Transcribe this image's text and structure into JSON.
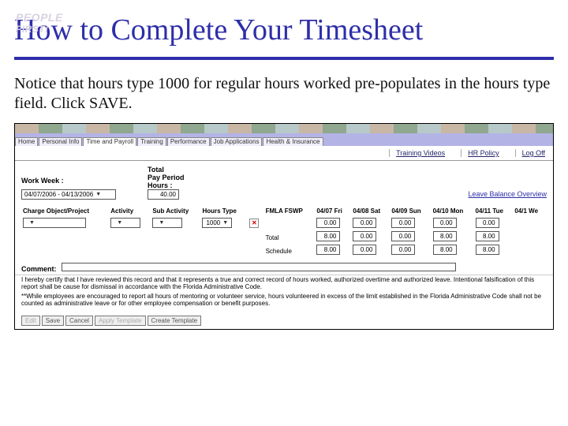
{
  "logo": {
    "line1": "PEOPLE",
    "line2": "FIRST!"
  },
  "title": "How to Complete Your Timesheet",
  "body": "Notice that hours type 1000 for regular hours worked pre-populates in the hours type field. Click SAVE.",
  "app": {
    "tabs": [
      "Home",
      "Personal Info",
      "Time and Payroll",
      "Training",
      "Performance",
      "Job Applications",
      "Health & Insurance"
    ],
    "active_tab": 2,
    "util": {
      "videos": "Training Videos",
      "policy": "HR Policy",
      "logoff": "Log Off"
    },
    "work_week": {
      "label": "Work Week :",
      "value": "04/07/2006 - 04/13/2006"
    },
    "pay_period": {
      "label1": "Total",
      "label2": "Pay Period",
      "label3": "Hours :",
      "value": "40.00"
    },
    "leave_link": "Leave Balance Overview",
    "headers": {
      "charge": "Charge Object/Project",
      "activity": "Activity",
      "sub": "Sub Activity",
      "htype": "Hours Type",
      "fmla": "FMLA FSWP",
      "d1": "04/07 Fri",
      "d2": "04/08 Sat",
      "d3": "04/09 Sun",
      "d4": "04/10 Mon",
      "d5": "04/11 Tue",
      "d6": "04/1 We"
    },
    "row": {
      "htype": "1000",
      "vals": [
        "0.00",
        "0.00",
        "0.00",
        "0.00",
        "0.00"
      ]
    },
    "total": {
      "label": "Total",
      "vals": [
        "8.00",
        "0.00",
        "0.00",
        "8.00",
        "8.00"
      ]
    },
    "schedule": {
      "label": "Schedule",
      "vals": [
        "8.00",
        "0.00",
        "0.00",
        "8.00",
        "8.00"
      ]
    },
    "comment": {
      "label": "Comment:"
    },
    "disc1": "I hereby certify that I have reviewed this record and that it represents a true and correct record of hours worked, authorized overtime and authorized leave. Intentional falsification of this report shall be cause for dismissal in accordance with the Florida Administrative Code.",
    "disc2": "**While employees are encouraged to report all hours of mentoring or volunteer service, hours volunteered in excess of the limit established in the Florida Administrative Code shall not be counted as administrative leave or for other employee compensation or benefit purposes.",
    "buttons": {
      "edit": "Edit",
      "save": "Save",
      "cancel": "Cancel",
      "apply": "Apply Template",
      "create": "Create Template"
    }
  }
}
